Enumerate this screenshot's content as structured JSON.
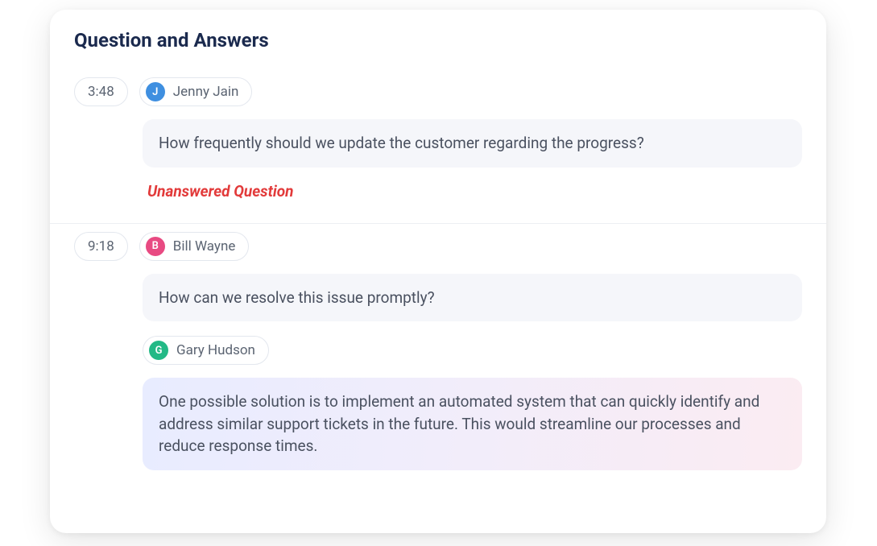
{
  "title": "Question and Answers",
  "unanswered_label": "Unanswered Question",
  "avatar_colors": {
    "jenny": "#3f8fe0",
    "bill": "#e84a82",
    "gary": "#23b986"
  },
  "threads": [
    {
      "time": "3:48",
      "asker": {
        "initial": "J",
        "name": "Jenny Jain",
        "color_key": "jenny"
      },
      "question": "How frequently should we update the customer regarding the progress?",
      "answered": false
    },
    {
      "time": "9:18",
      "asker": {
        "initial": "B",
        "name": "Bill Wayne",
        "color_key": "bill"
      },
      "question": "How can we resolve this issue promptly?",
      "answered": true,
      "answer": {
        "author": {
          "initial": "G",
          "name": "Gary Hudson",
          "color_key": "gary"
        },
        "text": "One possible solution is to implement an automated system that can quickly identify and address similar support tickets in the future. This would streamline our processes and reduce response times."
      }
    }
  ]
}
